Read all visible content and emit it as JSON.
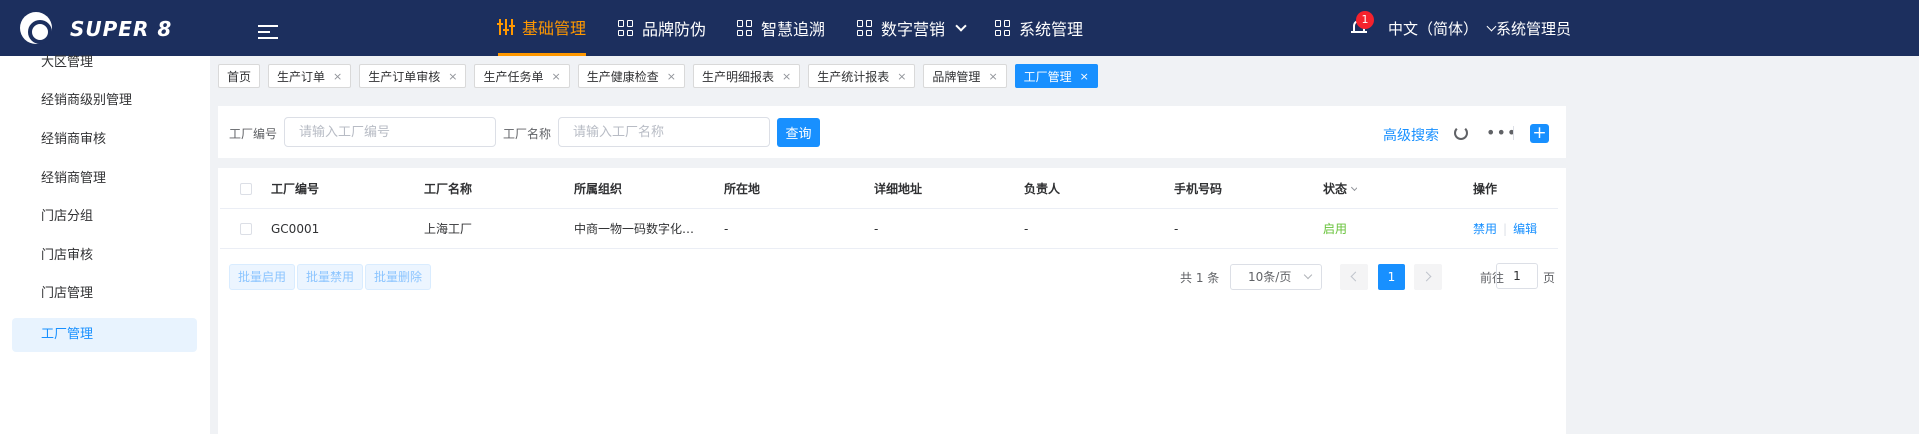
{
  "header": {
    "brand": "SUPER 8",
    "nav": [
      {
        "label": "基础管理",
        "icon": "sliders-icon",
        "active": true
      },
      {
        "label": "品牌防伪",
        "icon": "grid-icon"
      },
      {
        "label": "智慧追溯",
        "icon": "grid-icon"
      },
      {
        "label": "数字营销",
        "icon": "grid-icon",
        "dropdown": true
      },
      {
        "label": "系统管理",
        "icon": "grid-icon"
      }
    ],
    "notification_count": "1",
    "language": "中文（简体）",
    "user": "系统管理员"
  },
  "sidebar": {
    "items": [
      {
        "label": "大区管理"
      },
      {
        "label": "经销商级别管理"
      },
      {
        "label": "经销商审核"
      },
      {
        "label": "经销商管理"
      },
      {
        "label": "门店分组"
      },
      {
        "label": "门店审核"
      },
      {
        "label": "门店管理"
      },
      {
        "label": "工厂管理",
        "active": true
      }
    ]
  },
  "tabs": [
    {
      "label": "首页",
      "closable": false
    },
    {
      "label": "生产订单",
      "closable": true
    },
    {
      "label": "生产订单审核",
      "closable": true
    },
    {
      "label": "生产任务单",
      "closable": true
    },
    {
      "label": "生产健康检查",
      "closable": true
    },
    {
      "label": "生产明细报表",
      "closable": true
    },
    {
      "label": "生产统计报表",
      "closable": true
    },
    {
      "label": "品牌管理",
      "closable": true
    },
    {
      "label": "工厂管理",
      "closable": true,
      "active": true
    }
  ],
  "search": {
    "factory_code_label": "工厂编号",
    "factory_code_placeholder": "请输入工厂编号",
    "factory_name_label": "工厂名称",
    "factory_name_placeholder": "请输入工厂名称",
    "query_button": "查询",
    "advanced_search": "高级搜索"
  },
  "table": {
    "columns": [
      "工厂编号",
      "工厂名称",
      "所属组织",
      "所在地",
      "详细地址",
      "负责人",
      "手机号码",
      "状态",
      "操作"
    ],
    "rows": [
      {
        "code": "GC0001",
        "name": "上海工厂",
        "org": "中商一物一码数字化全...",
        "location": "-",
        "address": "-",
        "owner": "-",
        "phone": "-",
        "status": "启用",
        "actions": [
          "禁用",
          "编辑"
        ]
      }
    ]
  },
  "bulk_actions": [
    "批量启用",
    "批量禁用",
    "批量删除"
  ],
  "pagination": {
    "total": "共 1 条",
    "page_size": "10条/页",
    "current_page": "1",
    "goto_label": "前往",
    "goto_value": "1",
    "page_suffix": "页"
  },
  "colors": {
    "header_bg": "#1c2f5e",
    "accent": "#1890ff",
    "active_nav": "#ff9800",
    "status_enabled": "#67c23a"
  }
}
